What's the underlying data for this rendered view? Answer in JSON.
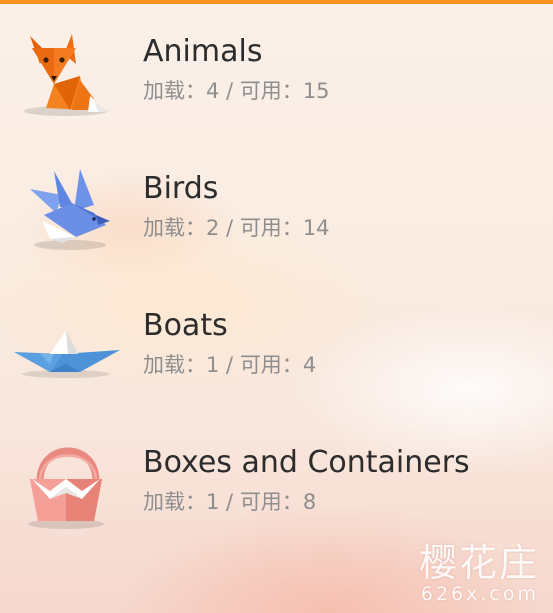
{
  "theme": {
    "accent": "#f7931e",
    "title_color": "#2c2c2c",
    "subtitle_color": "#8e8e8e"
  },
  "categories": [
    {
      "title": "Animals",
      "loaded_label": "加载：",
      "loaded": "4",
      "separator": " / ",
      "available_label": "可用：",
      "available": "15",
      "icon": "origami-fox-icon"
    },
    {
      "title": "Birds",
      "loaded_label": "加载：",
      "loaded": "2",
      "separator": " / ",
      "available_label": "可用：",
      "available": "14",
      "icon": "origami-bird-icon"
    },
    {
      "title": "Boats",
      "loaded_label": "加载：",
      "loaded": "1",
      "separator": " / ",
      "available_label": "可用：",
      "available": "4",
      "icon": "origami-boat-icon"
    },
    {
      "title": "Boxes and Containers",
      "loaded_label": "加载：",
      "loaded": "1",
      "separator": " / ",
      "available_label": "可用：",
      "available": "8",
      "icon": "origami-basket-icon"
    }
  ],
  "watermark": {
    "logo": "樱花庄",
    "url": "626x.com"
  }
}
